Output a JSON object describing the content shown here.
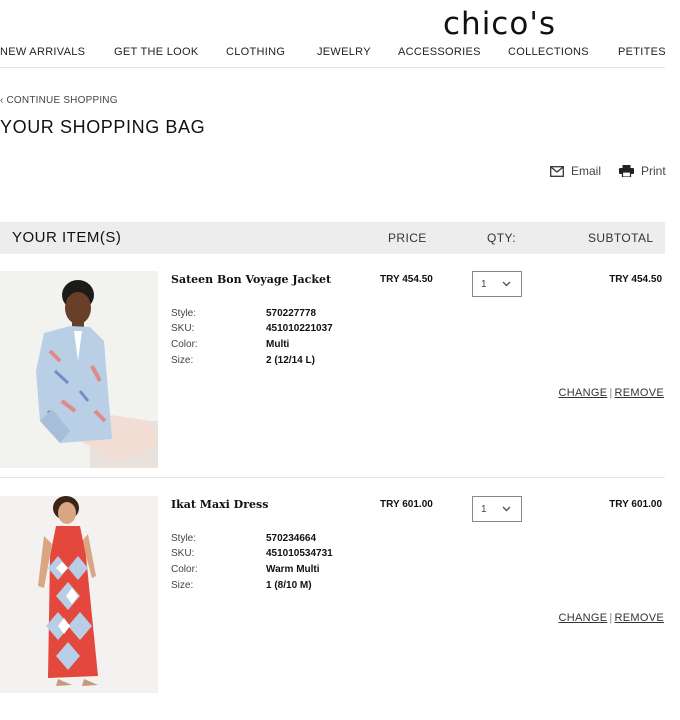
{
  "brand": {
    "logo": "chico's"
  },
  "nav": [
    "NEW ARRIVALS",
    "GET THE LOOK",
    "CLOTHING",
    "JEWELRY",
    "ACCESSORIES",
    "COLLECTIONS",
    "PETITES"
  ],
  "continue_link": "CONTINUE SHOPPING",
  "page_title": "YOUR SHOPPING BAG",
  "utilities": {
    "email": "Email",
    "print": "Print"
  },
  "table_header": {
    "items": "YOUR ITEM(S)",
    "price": "PRICE",
    "qty": "QTY:",
    "subtotal": "SUBTOTAL"
  },
  "attr_labels": {
    "style": "Style:",
    "sku": "SKU:",
    "color": "Color:",
    "size": "Size:"
  },
  "items": [
    {
      "name": "Sateen Bon Voyage Jacket",
      "style": "570227778",
      "sku": "451010221037",
      "color": "Multi",
      "size": "2 (12/14 L)",
      "price": "TRY 454.50",
      "qty": "1",
      "subtotal": "TRY 454.50",
      "change": "CHANGE",
      "remove": "REMOVE"
    },
    {
      "name": "Ikat Maxi Dress",
      "style": "570234664",
      "sku": "451010534731",
      "color": "Warm Multi",
      "size": "1 (8/10 M)",
      "price": "TRY 601.00",
      "qty": "1",
      "subtotal": "TRY 601.00",
      "change": "CHANGE",
      "remove": "REMOVE"
    }
  ],
  "colors": {
    "header_bg": "#ededed",
    "text": "#1a1a1a",
    "dress_red": "#e4473c",
    "jacket_blue": "#b9cfe6"
  }
}
